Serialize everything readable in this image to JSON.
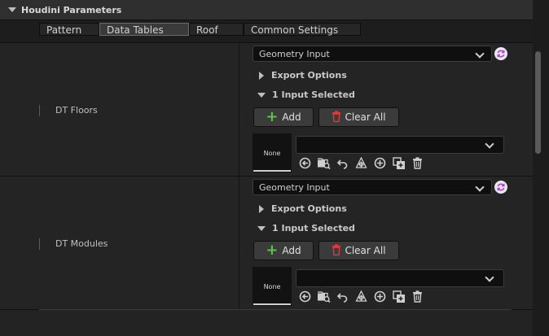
{
  "header": {
    "title": "Houdini Parameters"
  },
  "tabs": [
    {
      "label": "Pattern",
      "active": false
    },
    {
      "label": "Data Tables",
      "active": true
    },
    {
      "label": "Roof",
      "active": false
    },
    {
      "label": "Common Settings",
      "active": false
    }
  ],
  "rows": [
    {
      "label": "DT Floors",
      "input_type": "Geometry Input",
      "export_options": "Export Options",
      "selected_text": "1 Input Selected",
      "add_label": "Add",
      "clear_label": "Clear All",
      "thumb_label": "None",
      "asset_value": ""
    },
    {
      "label": "DT Modules",
      "input_type": "Geometry Input",
      "export_options": "Export Options",
      "selected_text": "1 Input Selected",
      "add_label": "Add",
      "clear_label": "Clear All",
      "thumb_label": "None",
      "asset_value": ""
    }
  ],
  "colors": {
    "accent_green": "#5fc24a",
    "trash_red": "#e03a3a",
    "reset_icon": "#b93bd6"
  },
  "icons": [
    "browse-back-icon",
    "find-in-browser-icon",
    "undo-icon",
    "actor-select-icon",
    "add-circle-icon",
    "duplicate-icon",
    "delete-icon"
  ]
}
